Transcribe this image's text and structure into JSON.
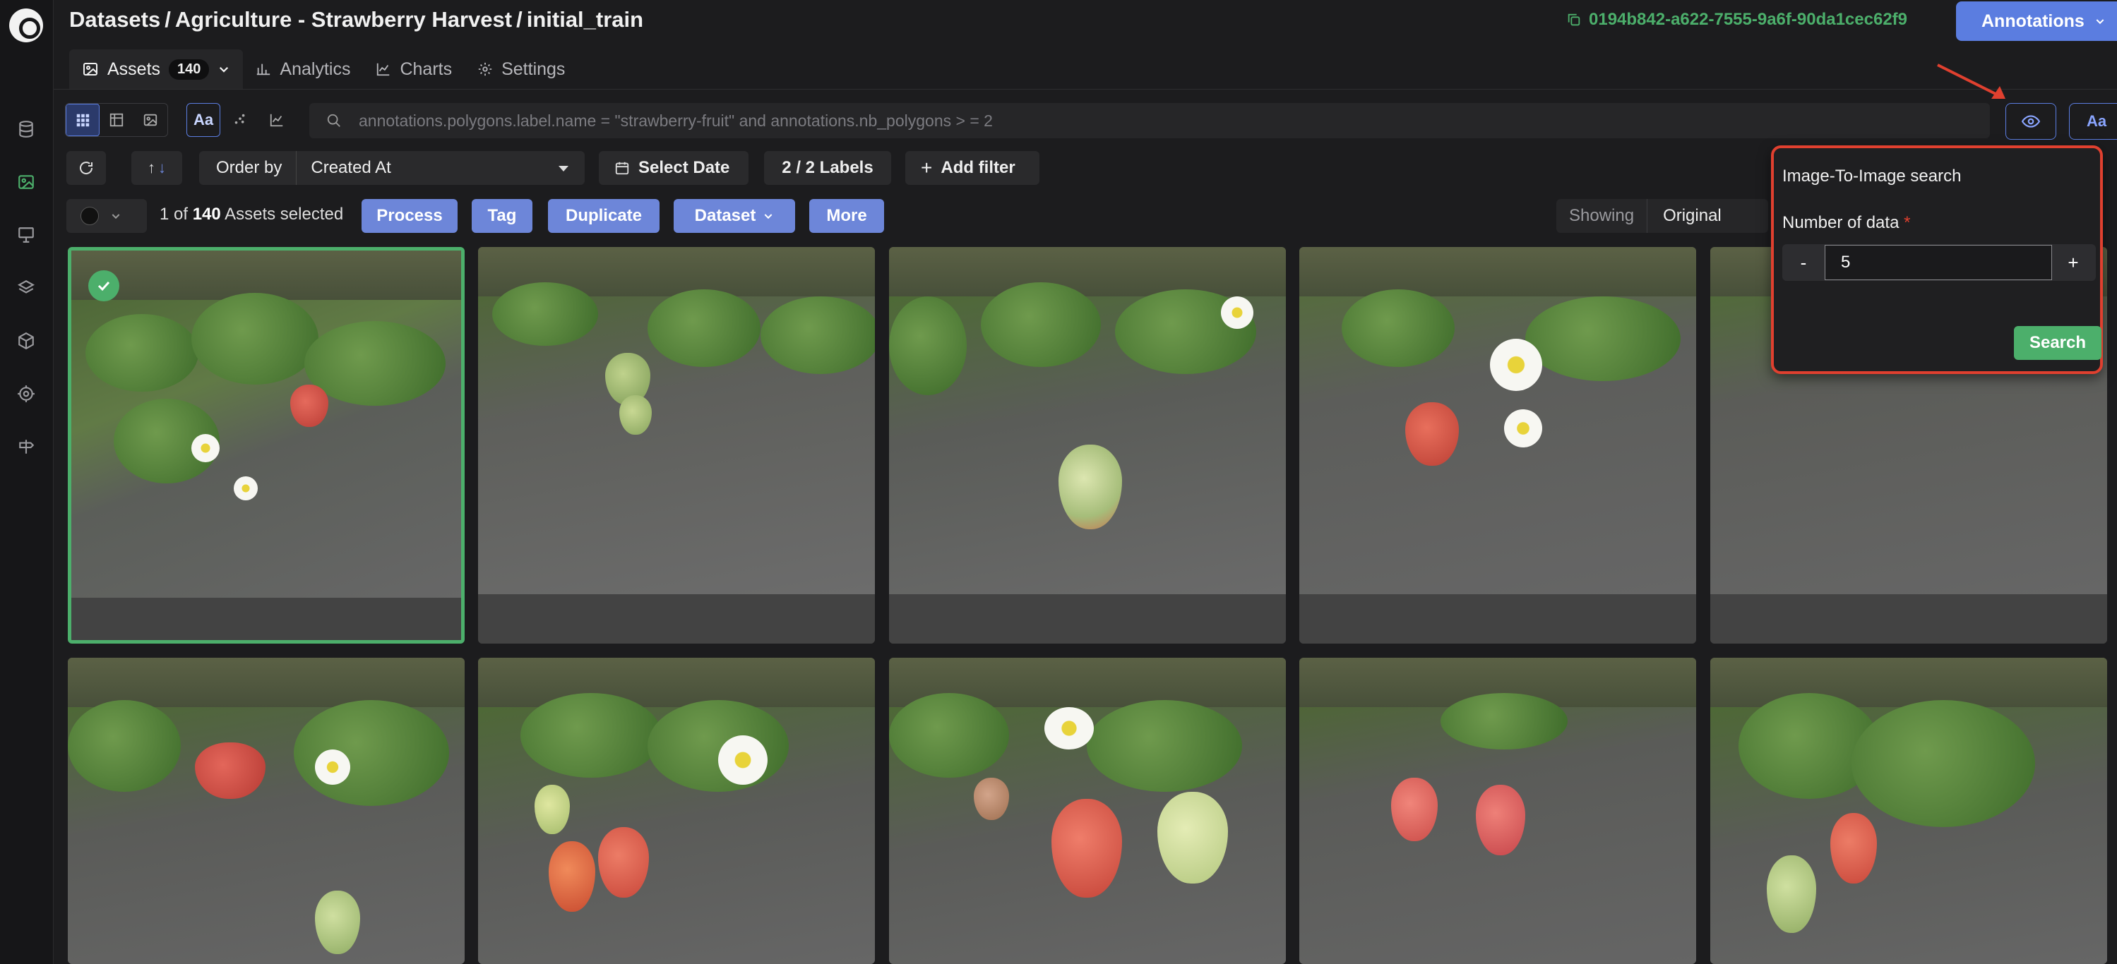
{
  "breadcrumb": {
    "datasets": "Datasets",
    "project": "Agriculture - Strawberry Harvest",
    "version": "initial_train"
  },
  "uuid": "0194b842-a622-7555-9a6f-90da1cec62f9",
  "annotations_button": "Annotations",
  "tabs": {
    "assets": "Assets",
    "assets_count": "140",
    "analytics": "Analytics",
    "charts": "Charts",
    "settings": "Settings"
  },
  "search": {
    "placeholder": "annotations.polygons.label.name = \"strawberry-fruit\" and annotations.nb_polygons > = 2",
    "text_mode_label": "Aa"
  },
  "toolbar": {
    "order_by_label": "Order by",
    "order_by_value": "Created At",
    "select_date": "Select Date",
    "labels": "2 / 2 Labels",
    "add_filter": "Add filter"
  },
  "selection": {
    "prefix": "1 of",
    "total": "140",
    "suffix": "Assets selected"
  },
  "actions": {
    "process": "Process",
    "tag": "Tag",
    "duplicate": "Duplicate",
    "dataset": "Dataset",
    "more": "More"
  },
  "showing": {
    "label": "Showing",
    "value": "Original"
  },
  "popup": {
    "title": "Image-To-Image search",
    "field_label": "Number of data",
    "required_mark": "*",
    "minus": "-",
    "plus": "+",
    "value": "5",
    "search_button": "Search"
  },
  "colors": {
    "accent_blue": "#5b7de0",
    "accent_green": "#4caf6b",
    "highlight_red": "#e0402f"
  }
}
